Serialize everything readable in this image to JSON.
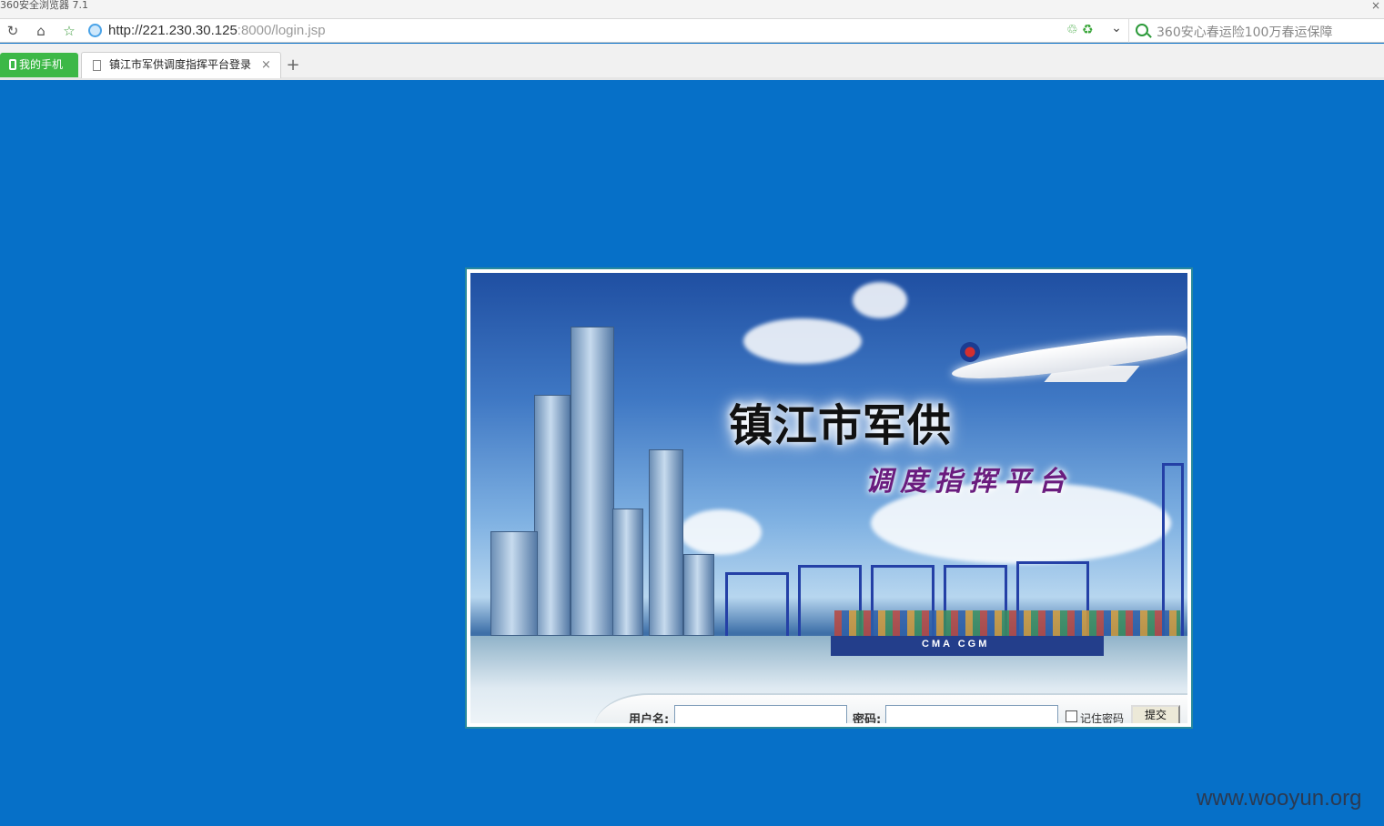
{
  "browser": {
    "window_title": "360安全浏览器 7.1",
    "close_glyph": "×",
    "url_host": "http://221.230.30.125",
    "url_path": ":8000/login.jsp",
    "search_placeholder": "360安心春运险100万春运保障",
    "mobile_tab_label": "我的手机",
    "tab_title": "镇江市军供调度指挥平台登录",
    "tab_close": "×",
    "new_tab": "+",
    "icons": {
      "back": "↻",
      "home": "⌂",
      "favorite": "☆",
      "dropdown": "⌄",
      "ext": "♲ ♻"
    }
  },
  "banner": {
    "title": "镇江市军供",
    "subtitle": "调度指挥平台",
    "ship_label": "CMA CGM"
  },
  "login": {
    "username_label": "用户名:",
    "username_value": "",
    "password_label": "密码:",
    "password_value": "",
    "remember_label": "记住密码",
    "remember_checked": false,
    "submit_label": "提交"
  },
  "watermark": "www.wooyun.org",
  "colors": {
    "page_background": "#0670c8",
    "frame_border": "#2a8a9c",
    "mobile_tab": "#3db847",
    "subtitle": "#6a1c7e"
  }
}
